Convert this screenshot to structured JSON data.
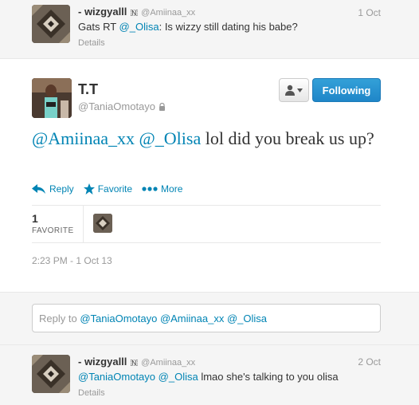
{
  "top_tweet": {
    "name": "- wizgyalll",
    "flag": "🇳",
    "handle": "@Amiinaa_xx",
    "time": "1 Oct",
    "text_prefix": "Gats RT ",
    "mention": "@_Olisa",
    "text_suffix": ": Is wizzy still dating his babe?",
    "details": "Details"
  },
  "main_tweet": {
    "name": "T.T",
    "handle": "@TaniaOmotayo",
    "follow_label": "Following",
    "mention_1": "@Amiinaa_xx",
    "mention_2": "@_Olisa",
    "text": " lol did you break us up?",
    "actions": {
      "reply": "Reply",
      "favorite": "Favorite",
      "more": "More"
    },
    "favorites_count": "1",
    "favorites_label": "FAVORITE",
    "timestamp": "2:23 PM - 1 Oct 13"
  },
  "reply_box": {
    "prefix": "Reply to ",
    "mentions": "@TaniaOmotayo @Amiinaa_xx @_Olisa"
  },
  "bottom_tweet": {
    "name": "- wizgyalll",
    "flag": "🇳",
    "handle": "@Amiinaa_xx",
    "time": "2 Oct",
    "mention_1": "@TaniaOmotayo",
    "mention_2": "@_Olisa",
    "text": " lmao she's talking to you olisa",
    "details": "Details"
  },
  "colors": {
    "link": "#0084b4",
    "follow_button": "#2a95d4"
  }
}
